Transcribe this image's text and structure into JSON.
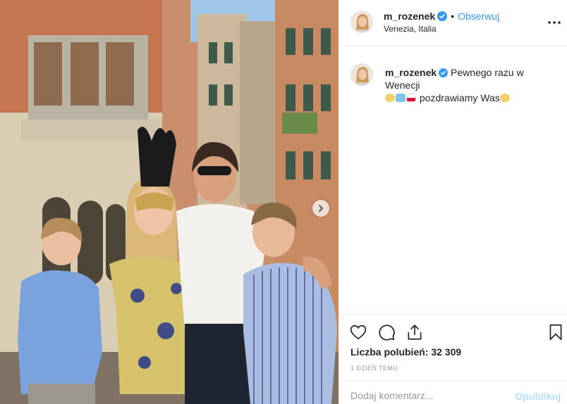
{
  "post": {
    "username": "m_rozenek",
    "follow_label": "Obserwuj",
    "location": "Venezia, Italia",
    "caption_text": "Pewnego razu w Wenecji",
    "caption_line2": "pozdrawiamy Was",
    "likes": "Liczba polubień: 32 309",
    "time_ago": "1 DZIEŃ TEMU",
    "comment_placeholder": "Dodaj komentarz...",
    "publish_label": "Opublikuj"
  },
  "icons": {
    "verified": "verified-badge-icon",
    "more": "more-options-icon",
    "like": "heart-icon",
    "comment": "comment-icon",
    "share": "share-icon",
    "save": "bookmark-icon",
    "next": "chevron-right-icon"
  },
  "colors": {
    "link": "#3897f0",
    "verified": "#3897f0",
    "publish_disabled": "#b2dffc"
  }
}
